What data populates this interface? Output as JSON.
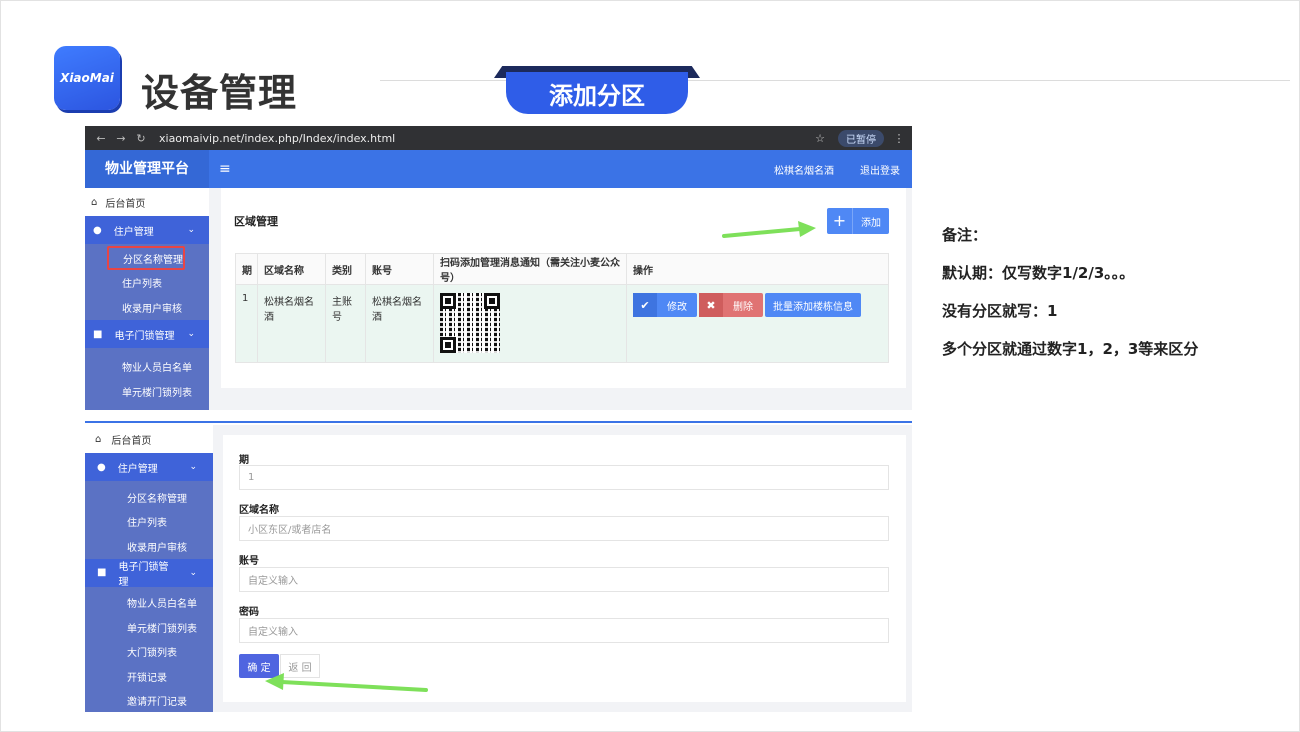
{
  "header": {
    "logo_text": "XiaoMai",
    "title": "设备管理",
    "banner_tab": "添加分区"
  },
  "browser": {
    "url": "xiaomaivip.net/index.php/Index/index.html",
    "paused_label": "已暂停"
  },
  "app": {
    "brand": "物业管理平台",
    "menu_icon": "≡",
    "user": "松棋名烟名酒",
    "logout": "退出登录"
  },
  "sidebar": {
    "home": "后台首页",
    "group1": "住户管理",
    "group1_items": [
      "分区名称管理",
      "住户列表",
      "收录用户审核"
    ],
    "group2": "电子门锁管理",
    "group2_items": [
      "物业人员白名单",
      "单元楼门锁列表"
    ]
  },
  "area": {
    "section_title": "区域管理",
    "add_label": "添加",
    "columns": [
      "期",
      "区域名称",
      "类别",
      "账号",
      "扫码添加管理消息通知（需关注小麦公众号）",
      "操作"
    ],
    "row": {
      "period": "1",
      "name": "松棋名烟名酒",
      "type": "主账号",
      "account": "松棋名烟名酒"
    },
    "ops": {
      "edit": "修改",
      "delete": "删除",
      "batch": "批量添加楼栋信息"
    }
  },
  "sidebar2": {
    "home": "后台首页",
    "group1": "住户管理",
    "group1_items": [
      "分区名称管理",
      "住户列表",
      "收录用户审核"
    ],
    "group2": "电子门锁管理",
    "group2_items": [
      "物业人员白名单",
      "单元楼门锁列表",
      "大门锁列表",
      "开锁记录",
      "邀请开门记录"
    ]
  },
  "form": {
    "fields": [
      {
        "label": "期",
        "placeholder": "1"
      },
      {
        "label": "区域名称",
        "placeholder": "小区东区/或者店名"
      },
      {
        "label": "账号",
        "placeholder": "自定义输入"
      },
      {
        "label": "密码",
        "placeholder": "自定义输入"
      }
    ],
    "ok": "确 定",
    "back": "返 回"
  },
  "notes": [
    "备注：",
    "默认期：仅写数字1/2/3。。。",
    "没有分区就写：1",
    "多个分区就通过数字1，2，3等来区分"
  ],
  "colors": {
    "primary": "#3b73e6",
    "sidebar": "#5b72c4",
    "danger": "#e07373",
    "arrow": "#7ee05a"
  }
}
